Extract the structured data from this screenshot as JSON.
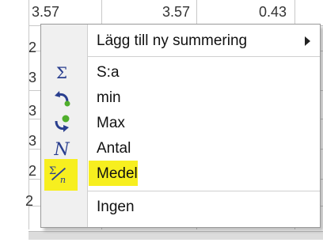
{
  "grid": {
    "top_values": [
      "3.57",
      "3.57",
      "0.43"
    ],
    "row_numbers": [
      "2",
      "3",
      "3",
      "3",
      "2",
      "2"
    ]
  },
  "menu": {
    "items": [
      {
        "label": "Lägg till ny summering",
        "icon": "none",
        "has_submenu": true
      },
      {
        "label": "S:a",
        "icon": "sigma-icon"
      },
      {
        "label": "min",
        "icon": "min-arrow-icon"
      },
      {
        "label": "Max",
        "icon": "max-arrow-icon"
      },
      {
        "label": "Antal",
        "icon": "count-n-icon"
      },
      {
        "label": "Medel",
        "icon": "mean-sigma-n-icon",
        "highlighted": true
      },
      {
        "label": "Ingen",
        "icon": "none"
      }
    ],
    "highlight_color": "#f7ef1f",
    "icon_blue": "#2a3f8f",
    "green_dot": "#4fae2b"
  }
}
